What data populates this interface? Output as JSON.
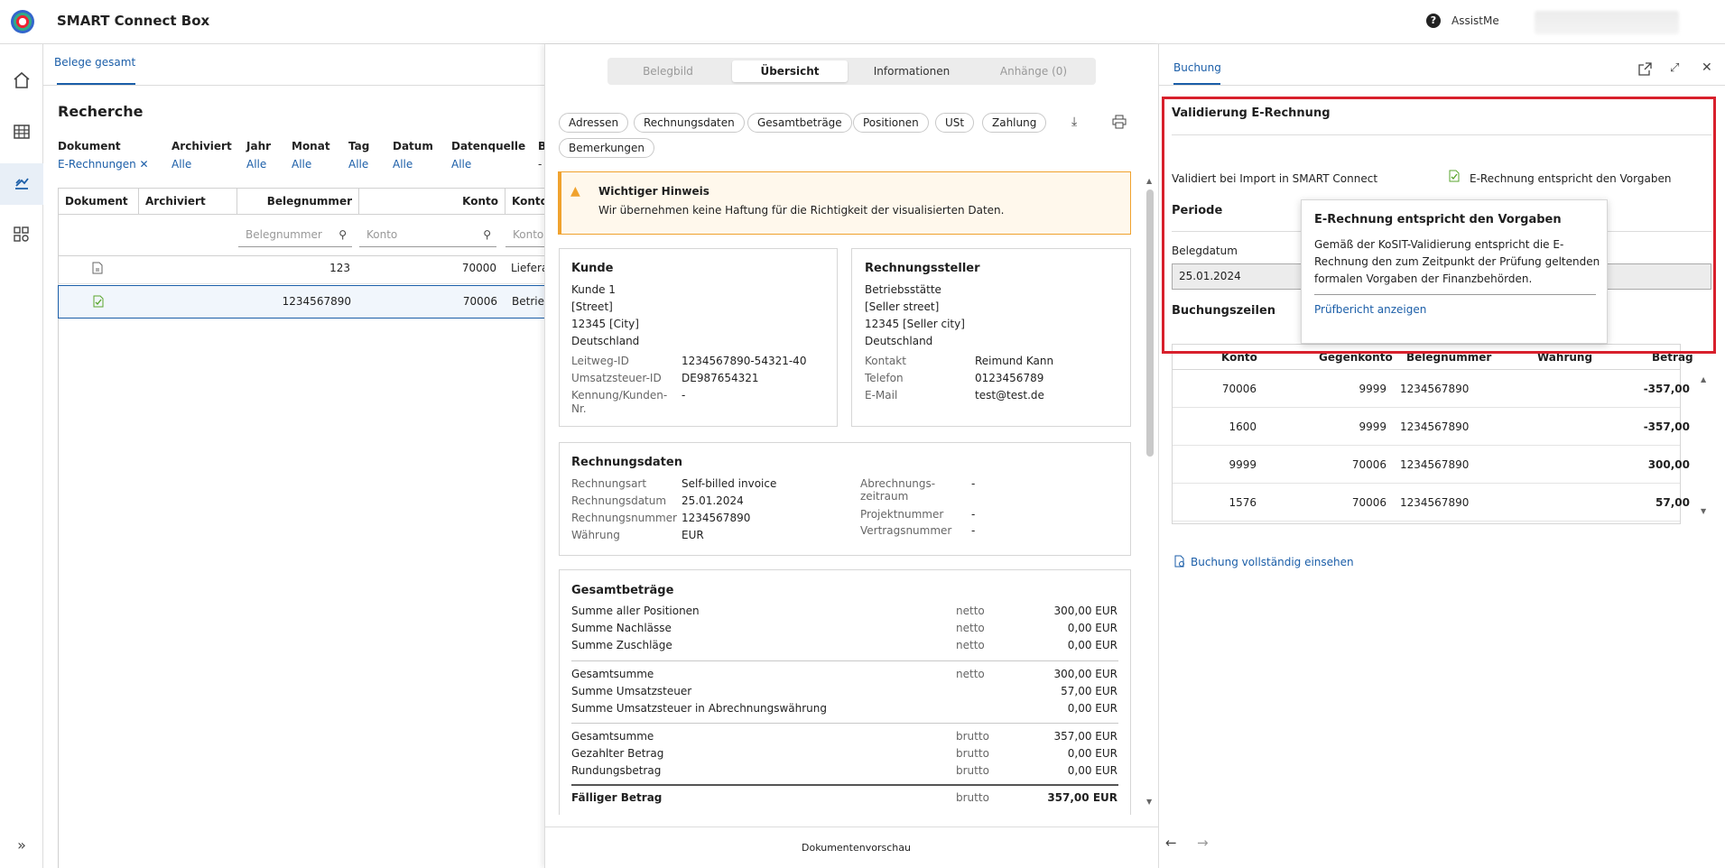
{
  "app": {
    "title": "SMART Connect Box",
    "help_label": "?",
    "assist_label": "AssistMe"
  },
  "left": {
    "tab_label": "Belege gesamt",
    "heading": "Recherche",
    "filters": [
      {
        "label": "Dokument",
        "value": "E-Rechnungen"
      },
      {
        "label": "Archiviert",
        "value": "Alle"
      },
      {
        "label": "Jahr",
        "value": "Alle"
      },
      {
        "label": "Monat",
        "value": "Alle"
      },
      {
        "label": "Tag",
        "value": "Alle"
      },
      {
        "label": "Datum",
        "value": "Alle"
      },
      {
        "label": "Datenquelle",
        "value": "Alle"
      },
      {
        "label": "B",
        "value": "-"
      }
    ],
    "columns": [
      "Dokument",
      "Archiviert",
      "Belegnummer",
      "Konto",
      "Konto"
    ],
    "search_placeholders": {
      "belegnummer": "Belegnummer",
      "konto": "Konto",
      "konto2": "Konto"
    },
    "rows": [
      {
        "belegnummer": "123",
        "konto": "70000",
        "text": "Liefera"
      },
      {
        "belegnummer": "1234567890",
        "konto": "70006",
        "text": "Betrie"
      }
    ]
  },
  "middle": {
    "tabs": [
      "Belegbild",
      "Übersicht",
      "Informationen",
      "Anhänge (0)"
    ],
    "chips": [
      "Adressen",
      "Rechnungsdaten",
      "Gesamtbeträge",
      "Positionen",
      "USt",
      "Zahlung",
      "Bemerkungen"
    ],
    "warning": {
      "title": "Wichtiger Hinweis",
      "text": "Wir übernehmen keine Haftung für die Richtigkeit der visualisierten Daten."
    },
    "kunde": {
      "title": "Kunde",
      "lines": [
        "Kunde 1",
        "[Street]",
        "12345 [City]",
        "Deutschland"
      ],
      "fields": [
        {
          "label": "Leitweg-ID",
          "value": "1234567890-54321-40"
        },
        {
          "label": "Umsatzsteuer-ID",
          "value": "DE987654321"
        },
        {
          "label": "Kennung/Kunden-",
          "label2": "Nr.",
          "value": "-"
        }
      ]
    },
    "steller": {
      "title": "Rechnungssteller",
      "lines": [
        "Betriebsstätte",
        "[Seller street]",
        "12345 [Seller city]",
        "Deutschland"
      ],
      "fields": [
        {
          "label": "Kontakt",
          "value": "Reimund Kann"
        },
        {
          "label": "Telefon",
          "value": "0123456789"
        },
        {
          "label": "E-Mail",
          "value": "test@test.de"
        }
      ]
    },
    "rechnungsdaten": {
      "title": "Rechnungsdaten",
      "left": [
        {
          "label": "Rechnungsart",
          "value": "Self-billed invoice"
        },
        {
          "label": "Rechnungsdatum",
          "value": "25.01.2024"
        },
        {
          "label": "Rechnungsnummer",
          "value": "1234567890"
        },
        {
          "label": "Währung",
          "value": "EUR"
        }
      ],
      "right": [
        {
          "label": "Abrechnungs-",
          "label2": "zeitraum",
          "value": "-"
        },
        {
          "label": "Projektnummer",
          "value": "-"
        },
        {
          "label": "Vertragsnummer",
          "value": "-"
        }
      ]
    },
    "gesamt": {
      "title": "Gesamtbeträge",
      "rows": [
        {
          "label": "Summe aller Positionen",
          "type": "netto",
          "value": "300,00 EUR"
        },
        {
          "label": "Summe Nachlässe",
          "type": "netto",
          "value": "0,00 EUR"
        },
        {
          "label": "Summe Zuschläge",
          "type": "netto",
          "value": "0,00 EUR"
        },
        {
          "label": "Gesamtsumme",
          "type": "netto",
          "value": "300,00 EUR"
        },
        {
          "label": "Summe Umsatzsteuer",
          "type": "",
          "value": "57,00 EUR"
        },
        {
          "label": "Summe Umsatzsteuer in Abrechnungswährung",
          "type": "",
          "value": "0,00 EUR"
        },
        {
          "label": "Gesamtsumme",
          "type": "brutto",
          "value": "357,00 EUR"
        },
        {
          "label": "Gezahlter Betrag",
          "type": "brutto",
          "value": "0,00 EUR"
        },
        {
          "label": "Rundungsbetrag",
          "type": "brutto",
          "value": "0,00 EUR"
        },
        {
          "label": "Fälliger Betrag",
          "type": "brutto",
          "value": "357,00 EUR"
        }
      ]
    },
    "footer": "Dokumentenvorschau"
  },
  "right": {
    "tab_label": "Buchung",
    "validation": {
      "title": "Validierung E-Rechnung",
      "label": "Validiert bei Import in SMART Connect",
      "status": "E-Rechnung entspricht den Vorgaben"
    },
    "periode": {
      "title": "Periode",
      "belegdatum_label": "Belegdatum",
      "belegdatum_value": "25.01.2024"
    },
    "buchungszeilen": {
      "title": "Buchungszeilen",
      "columns": [
        "Konto",
        "Gegenkonto",
        "Belegnummer",
        "Währung",
        "Betrag"
      ],
      "rows": [
        {
          "konto": "70006",
          "gegenkonto": "9999",
          "beleg": "1234567890",
          "betrag": "-357,00"
        },
        {
          "konto": "1600",
          "gegenkonto": "9999",
          "beleg": "1234567890",
          "betrag": "-357,00"
        },
        {
          "konto": "9999",
          "gegenkonto": "70006",
          "beleg": "1234567890",
          "betrag": "300,00"
        },
        {
          "konto": "1576",
          "gegenkonto": "70006",
          "beleg": "1234567890",
          "betrag": "57,00"
        }
      ]
    },
    "popover": {
      "title": "E-Rechnung entspricht den Vorgaben",
      "line1": "Gemäß der KoSIT-Validierung entspricht die E-",
      "line2": "Rechnung den zum Zeitpunkt der Prüfung geltenden",
      "line3": "formalen Vorgaben der Finanzbehörden.",
      "link": "Prüfbericht anzeigen"
    },
    "link_full": "Buchung vollständig einsehen"
  },
  "colors": {
    "accent": "#1b5ea8",
    "highlight": "#d8202c",
    "warning": "#f0a22e",
    "valid": "#5aa52d"
  }
}
